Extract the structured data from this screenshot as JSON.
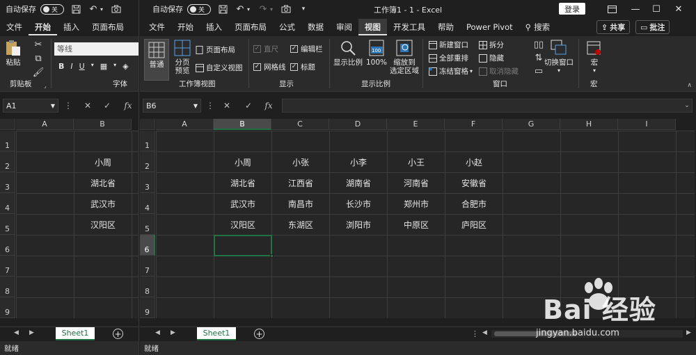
{
  "left": {
    "autosave_label": "自动保存",
    "toggle_label": "关",
    "tabs": [
      "文件",
      "开始",
      "插入",
      "页面布局"
    ],
    "active_tab": 1,
    "font_name": "等线",
    "paste_label": "粘贴",
    "clipboard_label": "剪贴板",
    "font_group_label": "字体",
    "bold": "B",
    "italic": "I",
    "underline": "U",
    "name_box": "A1",
    "columns": [
      "A",
      "B"
    ],
    "rows": [
      "1",
      "2",
      "3",
      "4",
      "5",
      "6",
      "7",
      "8",
      "9"
    ],
    "cells": [
      {
        "row": 2,
        "col": 2,
        "text": "小周"
      },
      {
        "row": 3,
        "col": 2,
        "text": "湖北省"
      },
      {
        "row": 4,
        "col": 2,
        "text": "武汉市"
      },
      {
        "row": 5,
        "col": 2,
        "text": "汉阳区"
      }
    ],
    "sheet_tab": "Sheet1",
    "status": "就绪"
  },
  "right": {
    "autosave_label": "自动保存",
    "toggle_label": "关",
    "window_title": "工作簿1  -  1  -  Excel",
    "login_label": "登录",
    "tabs": [
      "文件",
      "开始",
      "插入",
      "页面布局",
      "公式",
      "数据",
      "审阅",
      "视图",
      "开发工具",
      "帮助",
      "Power Pivot",
      "搜索"
    ],
    "active_tab": 7,
    "share_label": "共享",
    "comment_label": "批注",
    "ribbon": {
      "normal": "普通",
      "page_break": "分页\n预览",
      "page_layout": "页面布局",
      "custom_view": "自定义视图",
      "workbook_views_group": "工作簿视图",
      "ruler": "直尺",
      "formula_bar": "编辑栏",
      "gridlines": "网格线",
      "headings": "标题",
      "show_group": "显示",
      "zoom": "显示比例",
      "zoom100": "100%",
      "zoom_to_sel": "缩放到\n选定区域",
      "zoom_group": "显示比例",
      "zoom_badge": "100",
      "new_window": "新建窗口",
      "arrange_all": "全部重排",
      "freeze_panes": "冻结窗格",
      "split": "拆分",
      "hide": "隐藏",
      "unhide": "取消隐藏",
      "switch_windows": "切换窗口",
      "window_group": "窗口",
      "macros": "宏",
      "macros_group": "宏"
    },
    "name_box": "B6",
    "columns": [
      "A",
      "B",
      "C",
      "D",
      "E",
      "F",
      "G",
      "H",
      "I"
    ],
    "selected_col": 2,
    "rows": [
      "1",
      "2",
      "3",
      "4",
      "5",
      "6",
      "7",
      "8",
      "9"
    ],
    "selected_row": 6,
    "cells": [
      {
        "row": 2,
        "col": 2,
        "text": "小周"
      },
      {
        "row": 2,
        "col": 3,
        "text": "小张"
      },
      {
        "row": 2,
        "col": 4,
        "text": "小李"
      },
      {
        "row": 2,
        "col": 5,
        "text": "小王"
      },
      {
        "row": 2,
        "col": 6,
        "text": "小赵"
      },
      {
        "row": 3,
        "col": 2,
        "text": "湖北省"
      },
      {
        "row": 3,
        "col": 3,
        "text": "江西省"
      },
      {
        "row": 3,
        "col": 4,
        "text": "湖南省"
      },
      {
        "row": 3,
        "col": 5,
        "text": "河南省"
      },
      {
        "row": 3,
        "col": 6,
        "text": "安徽省"
      },
      {
        "row": 4,
        "col": 2,
        "text": "武汉市"
      },
      {
        "row": 4,
        "col": 3,
        "text": "南昌市"
      },
      {
        "row": 4,
        "col": 4,
        "text": "长沙市"
      },
      {
        "row": 4,
        "col": 5,
        "text": "郑州市"
      },
      {
        "row": 4,
        "col": 6,
        "text": "合肥市"
      },
      {
        "row": 5,
        "col": 2,
        "text": "汉阳区"
      },
      {
        "row": 5,
        "col": 3,
        "text": "东湖区"
      },
      {
        "row": 5,
        "col": 4,
        "text": "浏阳市"
      },
      {
        "row": 5,
        "col": 5,
        "text": "中原区"
      },
      {
        "row": 5,
        "col": 6,
        "text": "庐阳区"
      }
    ],
    "sheet_tab": "Sheet1",
    "status": "就绪"
  },
  "watermark": {
    "brand": "Bai 经验",
    "url": "jingyan.baidu.com"
  },
  "colors": {
    "accent": "#217346",
    "background": "#1f1f1f",
    "ribbon": "#2b2b2b"
  }
}
